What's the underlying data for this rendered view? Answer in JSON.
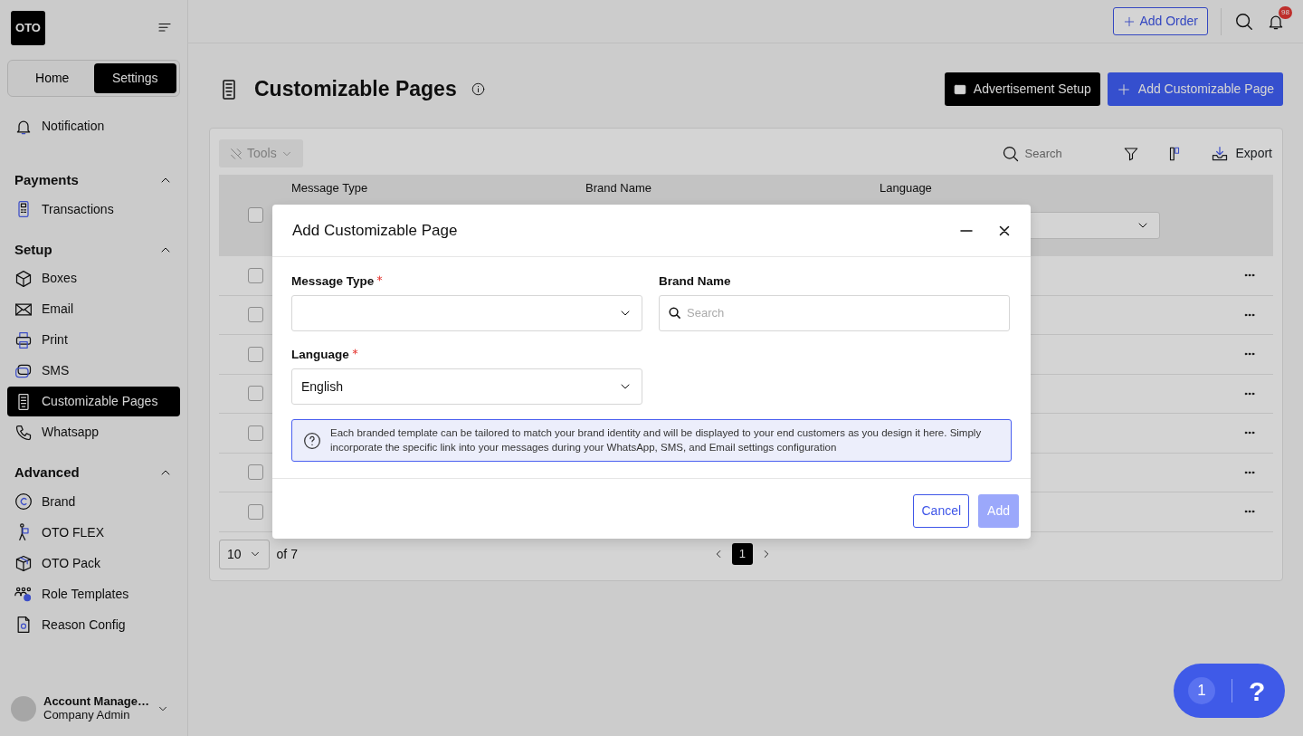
{
  "sidebar": {
    "logo": "OTO",
    "switcher": [
      {
        "label": "Home",
        "selected": false
      },
      {
        "label": "Settings",
        "selected": true
      }
    ],
    "top_items": [
      {
        "label": "Notification",
        "selected": false
      }
    ],
    "sections": [
      {
        "title": "Payments",
        "expanded": true,
        "items": [
          {
            "label": "Transactions",
            "selected": false
          }
        ]
      },
      {
        "title": "Setup",
        "expanded": true,
        "items": [
          {
            "label": "Boxes",
            "selected": false
          },
          {
            "label": "Email",
            "selected": false
          },
          {
            "label": "Print",
            "selected": false
          },
          {
            "label": "SMS",
            "selected": false
          },
          {
            "label": "Customizable Pages",
            "selected": true
          },
          {
            "label": "Whatsapp",
            "selected": false
          }
        ]
      },
      {
        "title": "Advanced",
        "expanded": true,
        "items": [
          {
            "label": "Brand",
            "selected": false
          },
          {
            "label": "OTO FLEX",
            "selected": false
          },
          {
            "label": "OTO Pack",
            "selected": false
          },
          {
            "label": "Role Templates",
            "selected": false
          },
          {
            "label": "Reason Config",
            "selected": false
          }
        ]
      }
    ],
    "account": {
      "name": "Account Manage…",
      "role": "Company Admin"
    }
  },
  "header": {
    "add_order": "Add Order",
    "notification_count": "98"
  },
  "page": {
    "title": "Customizable Pages",
    "buttons": [
      {
        "label": "Advertisement Setup",
        "kind": "dark"
      },
      {
        "label": "Add Customizable Page",
        "kind": "primary"
      }
    ]
  },
  "toolbar": {
    "tools": {
      "label": "Tools",
      "disabled": true
    },
    "search": {
      "placeholder": "Search"
    },
    "export": "Export"
  },
  "table": {
    "select_all_checked": false,
    "columns": [
      "Message Type",
      "Brand Name",
      "Language"
    ],
    "rows": [
      {
        "checked": false
      },
      {
        "checked": false
      },
      {
        "checked": false
      },
      {
        "checked": false
      },
      {
        "checked": false
      },
      {
        "checked": false
      },
      {
        "checked": false
      }
    ]
  },
  "pagination": {
    "page_size": "10",
    "of": "of 7",
    "pages": [
      {
        "label": "1",
        "selected": true
      }
    ]
  },
  "modal": {
    "title": "Add Customizable Page",
    "fields": [
      {
        "label": "Message Type",
        "required": true,
        "kind": "select"
      },
      {
        "label": "Brand Name",
        "required": false,
        "kind": "search",
        "placeholder": "Search"
      },
      {
        "label": "Language",
        "required": true,
        "kind": "select",
        "value": "English"
      }
    ],
    "info": "Each branded template can be tailored to match your brand identity and will be displayed to your end customers as you design it here. Simply incorporate the specific link into your messages during your WhatsApp, SMS, and Email settings configuration",
    "buttons": [
      {
        "label": "Cancel",
        "kind": "outline",
        "disabled": false
      },
      {
        "label": "Add",
        "kind": "primary",
        "disabled": true
      }
    ]
  },
  "help_widget": {
    "count": "1",
    "label": "?"
  }
}
